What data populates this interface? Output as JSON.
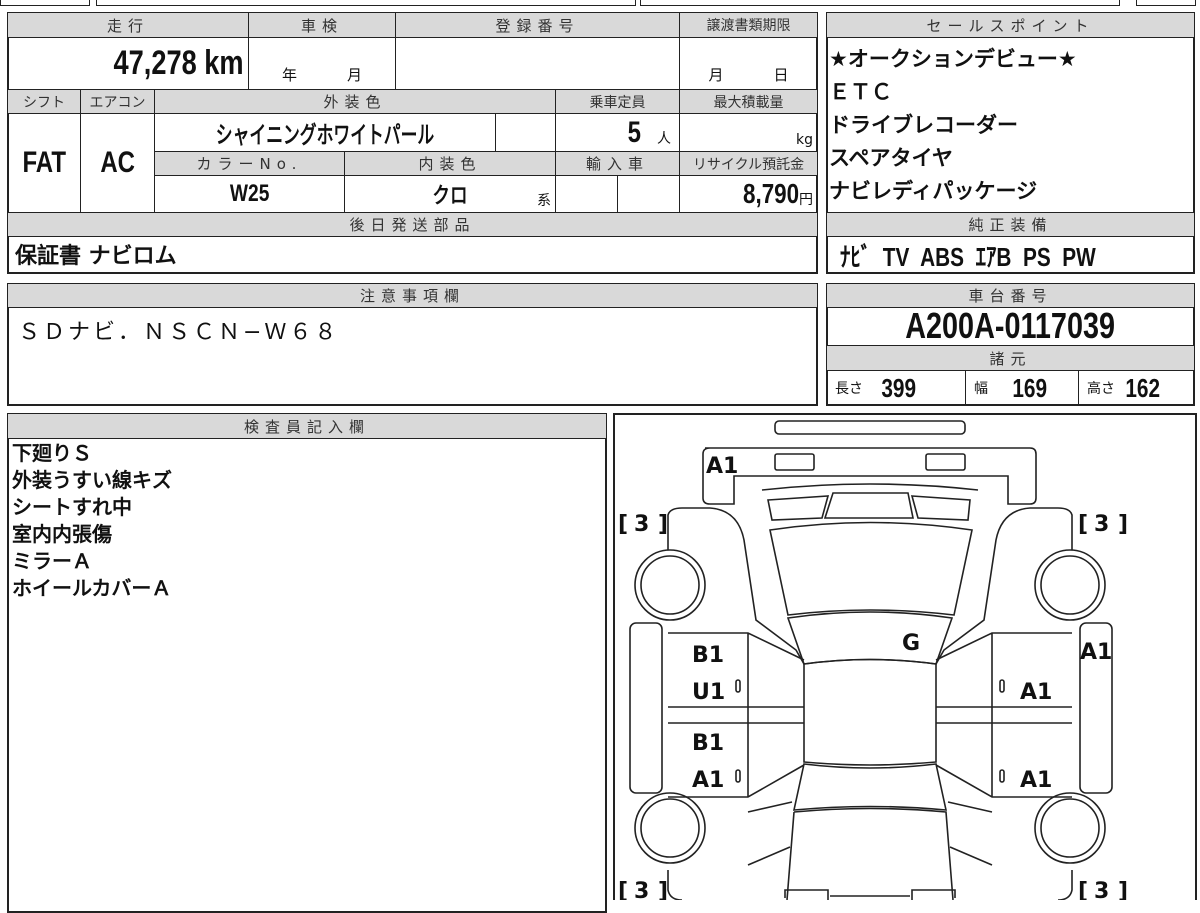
{
  "basic": {
    "mileage_label": "走行",
    "mileage": "47,278 km",
    "shaken_label": "車検",
    "shaken_year": "年",
    "shaken_month": "月",
    "reg_label": "登録番号",
    "transfer_label": "譲渡書類期限",
    "transfer_month": "月",
    "transfer_day": "日",
    "shift_label": "シフト",
    "shift": "FAT",
    "ac_label": "エアコン",
    "ac": "AC",
    "ext_color_label": "外装色",
    "ext_color": "シャイニングホワイトパール",
    "capacity_label": "乗車定員",
    "capacity": "5",
    "capacity_unit": "人",
    "load_label": "最大積載量",
    "load_unit": "kg",
    "color_no_label": "カラーNo.",
    "color_no": "W25",
    "int_color_label": "内装色",
    "int_color": "クロ",
    "int_color_suffix": "系",
    "import_label": "輸入車",
    "recycle_label": "リサイクル預託金",
    "recycle": "8,790",
    "recycle_unit": "円",
    "later_parts_label": "後日発送部品",
    "later_parts": "保証書 ナビロム"
  },
  "sales": {
    "label": "セールスポイント",
    "items": [
      "★オークションデビュー★",
      "ＥＴＣ",
      "ドライブレコーダー",
      "スペアタイヤ",
      "ナビレディパッケージ"
    ]
  },
  "equipment": {
    "label": "純正装備",
    "value": "ﾅﾋﾞ  TV  ABS  ｴｱB  PS  PW"
  },
  "notes": {
    "label": "注意事項欄",
    "value": "ＳＤナビ．ＮＳＣＮ−Ｗ６８"
  },
  "chassis": {
    "label": "車台番号",
    "value": "A200A-0117039"
  },
  "specs": {
    "label": "諸元",
    "length_label": "長さ",
    "length": "399",
    "width_label": "幅",
    "width": "169",
    "height_label": "高さ",
    "height": "162"
  },
  "inspector": {
    "label": "検査員記入欄",
    "items": [
      "下廻りＳ",
      "外装うすい線キズ",
      "シートすれ中",
      "室内内張傷",
      "ミラーＡ",
      "ホイールカバーＡ"
    ]
  },
  "diagram": {
    "marks": {
      "front_bumper": "A1",
      "windshield": "G",
      "left_front_door_1": "B1",
      "left_front_door_2": "U1",
      "left_rear_door_1": "B1",
      "left_rear_door_2": "A1",
      "right_front_door": "A1",
      "right_rear_door": "A1",
      "right_side": "A1"
    },
    "tire": "3"
  }
}
